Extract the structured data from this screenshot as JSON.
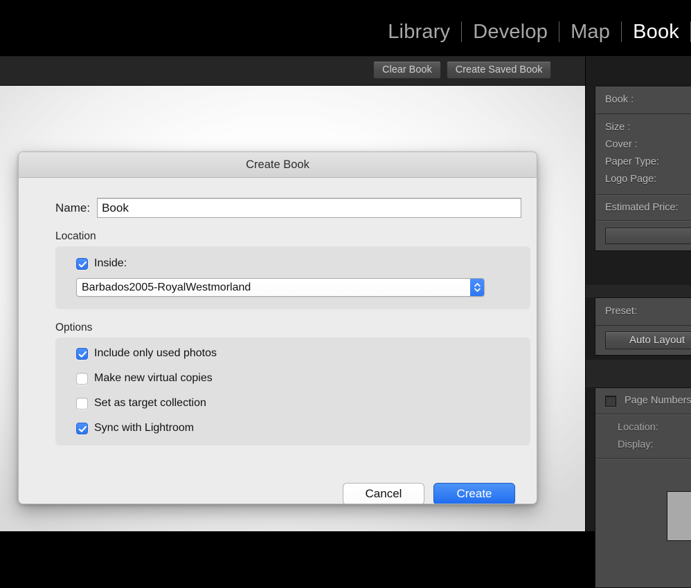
{
  "modules": [
    {
      "label": "Library",
      "active": false
    },
    {
      "label": "Develop",
      "active": false
    },
    {
      "label": "Map",
      "active": false
    },
    {
      "label": "Book",
      "active": true
    }
  ],
  "toolbar": {
    "clear_book_label": "Clear Book",
    "create_saved_book_label": "Create Saved Book"
  },
  "dialog": {
    "title": "Create Book",
    "name_label": "Name:",
    "name_value": "Book",
    "name_placeholder": "Book",
    "location": {
      "group_title": "Location",
      "inside_label": "Inside:",
      "inside_checked": true,
      "folder_value": "Barbados2005-RoyalWestmorland"
    },
    "options": {
      "group_title": "Options",
      "items": [
        {
          "label": "Include only used photos",
          "checked": true
        },
        {
          "label": "Make new virtual copies",
          "checked": false
        },
        {
          "label": "Set as target collection",
          "checked": false
        },
        {
          "label": "Sync with Lightroom",
          "checked": true
        }
      ]
    },
    "cancel_label": "Cancel",
    "create_label": "Create"
  },
  "right_panel": {
    "book_settings": {
      "header": "Book :",
      "rows": [
        "Size :",
        "Cover :",
        "Paper Type:",
        "Logo Page:"
      ],
      "estimated_price_label": "Estimated Price:"
    },
    "auto_layout": {
      "preset_label": "Preset:",
      "auto_layout_label": "Auto Layout"
    },
    "page": {
      "page_numbers_label": "Page Numbers",
      "page_numbers_checked": false,
      "location_label": "Location:",
      "display_label": "Display:"
    }
  },
  "colors": {
    "accent_blue": "#2f76f0",
    "panel_bg": "#4a4a4a",
    "chrome_bg": "#262626",
    "dialog_bg": "#ececec"
  }
}
